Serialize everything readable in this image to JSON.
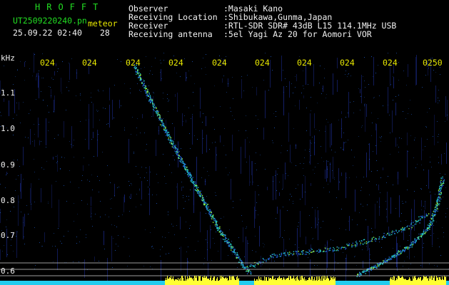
{
  "header": {
    "logo": "HROFFT",
    "filename": "UT2509220240.pn",
    "meteor_label": "meteor",
    "datetime": "25.09.22 02:40",
    "meteor_count": "28",
    "info_labels": [
      "Observer",
      "Receiving Location",
      "Receiver",
      "Receiving antenna"
    ],
    "info_values": [
      ":Masaki Kano",
      ":Shibukawa,Gunma,Japan",
      ":RTL-SDR SDR# 43dB L15 114.1MHz USB",
      ":5el Yagi Az 20 for Aomori VOR"
    ]
  },
  "plot": {
    "y_unit": "kHz",
    "y_ticks": [
      "1.1",
      "1.0",
      "0.9",
      "0.8",
      "0.7",
      "0.6"
    ],
    "x_ticks": [
      "024",
      "024",
      "024",
      "024",
      "024",
      "024",
      "024",
      "024",
      "024",
      "0250"
    ],
    "colors": {
      "background": "#000000",
      "noise": "#1a2a8c",
      "signal_low": "#1f5fd0",
      "signal_mid": "#22c8c8",
      "signal_high": "#9aff3a",
      "spectrum": "#ffff33",
      "spectrum_edge": "#22ccee"
    }
  }
}
